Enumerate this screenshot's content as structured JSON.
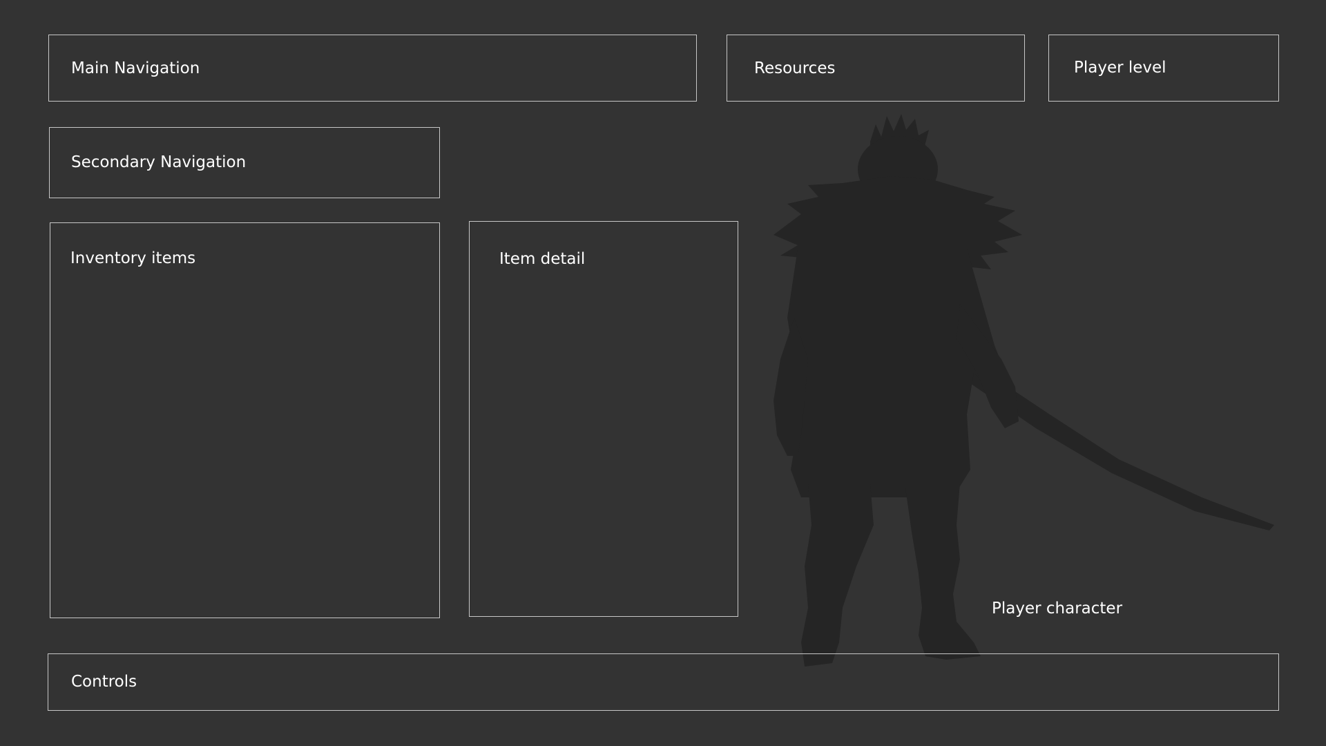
{
  "panels": {
    "main_navigation": "Main Navigation",
    "resources": "Resources",
    "player_level": "Player level",
    "secondary_navigation": "Secondary Navigation",
    "inventory_items": "Inventory items",
    "item_detail": "Item detail",
    "player_character": "Player character",
    "controls": "Controls"
  },
  "colors": {
    "background": "#333333",
    "panel_border": "#c8c8c8",
    "silhouette": "#252525",
    "text": "#ffffff"
  },
  "icons": {
    "player_character": "warrior-silhouette"
  }
}
